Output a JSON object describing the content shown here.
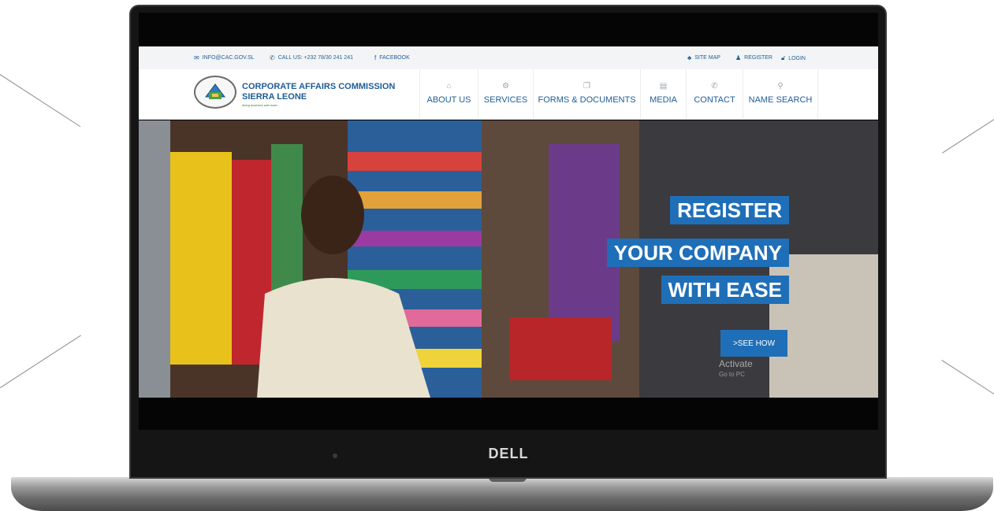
{
  "topbar": {
    "email": "INFO@CAC.GOV.SL",
    "phone": "CALL US: +232 78/30 241 241",
    "facebook": "FACEBOOK",
    "site_map": "SITE MAP",
    "register": "REGISTER",
    "login": "LOGIN"
  },
  "logo": {
    "line1": "CORPORATE AFFAIRS COMMISSION",
    "line2": "SIERRA LEONE",
    "tagline": "doing business with ease..."
  },
  "nav": [
    {
      "label": "ABOUT US",
      "icon": "building-icon"
    },
    {
      "label": "SERVICES",
      "icon": "gear-icon"
    },
    {
      "label": "FORMS & DOCUMENTS",
      "icon": "documents-icon"
    },
    {
      "label": "MEDIA",
      "icon": "media-icon"
    },
    {
      "label": "CONTACT",
      "icon": "phone-icon"
    },
    {
      "label": "NAME SEARCH",
      "icon": "search-icon"
    }
  ],
  "hero": {
    "line1": "REGISTER",
    "line2": "YOUR COMPANY",
    "line3": "WITH EASE",
    "cta": ">SEE HOW",
    "watermark_1": "Activate",
    "watermark_2": "Go to PC"
  },
  "device": {
    "brand": "DELL"
  },
  "colors": {
    "brand_blue": "#1f6fb8",
    "nav_text": "#1f5d96"
  }
}
